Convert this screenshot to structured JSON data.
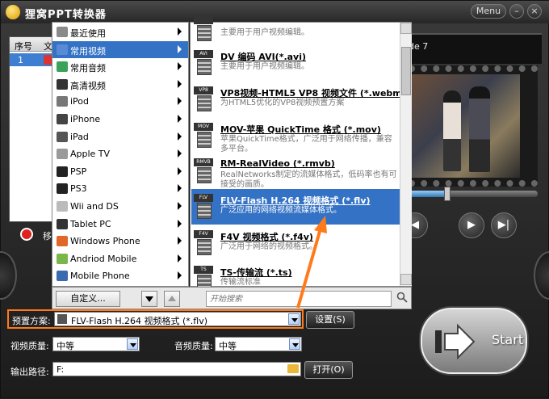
{
  "title": "狸窝PPT转换器",
  "window_buttons": {
    "menu": "Menu",
    "minimize": "–",
    "close": "×"
  },
  "filelist": {
    "col_index": "序号",
    "col_file": "文",
    "rows": [
      {
        "index": "1"
      }
    ],
    "delete_label": "移"
  },
  "preview": {
    "slide_label": "de 7",
    "seek_fraction": 0.3
  },
  "categories": [
    {
      "label": "最近使用",
      "icon": "clock-icon",
      "color": "#8a8a8a"
    },
    {
      "label": "常用视频",
      "icon": "film-icon",
      "color": "#5a8ad6"
    },
    {
      "label": "常用音频",
      "icon": "audio-icon",
      "color": "#3aa35a"
    },
    {
      "label": "高清视频",
      "icon": "hd-icon",
      "color": "#333333"
    },
    {
      "label": "iPod",
      "icon": "ipod-icon",
      "color": "#777777"
    },
    {
      "label": "iPhone",
      "icon": "iphone-icon",
      "color": "#444444"
    },
    {
      "label": "iPad",
      "icon": "ipad-icon",
      "color": "#555555"
    },
    {
      "label": "Apple TV",
      "icon": "apple-icon",
      "color": "#9a9a9a"
    },
    {
      "label": "PSP",
      "icon": "psp-icon",
      "color": "#222222"
    },
    {
      "label": "PS3",
      "icon": "ps3-icon",
      "color": "#222222"
    },
    {
      "label": "Wii and DS",
      "icon": "wii-icon",
      "color": "#bbbbbb"
    },
    {
      "label": "Tablet PC",
      "icon": "tablet-icon",
      "color": "#333333"
    },
    {
      "label": "Windows Phone",
      "icon": "windows-icon",
      "color": "#e0662a"
    },
    {
      "label": "Andriod Mobile",
      "icon": "android-icon",
      "color": "#7ab648"
    },
    {
      "label": "Mobile Phone",
      "icon": "phone-icon",
      "color": "#3a6ab0"
    }
  ],
  "selected_category": 1,
  "formats": [
    {
      "tag": "",
      "title": "",
      "desc": "主要用于用户视频编辑。"
    },
    {
      "tag": "AVI",
      "title": "DV 编码 AVI(*.avi)",
      "desc": "主要用于用户视频编辑。"
    },
    {
      "tag": "VP8",
      "title": "VP8视频-HTML5 VP8 视频文件 (*.webm)",
      "desc": "为HTML5优化的VP8视频预置方案"
    },
    {
      "tag": "MOV",
      "title": "MOV-苹果 QuickTime 格式 (*.mov)",
      "desc": "苹果QuickTime格式，广泛用于网络传播，兼容多平台。"
    },
    {
      "tag": "RMVB",
      "title": "RM-RealVideo (*.rmvb)",
      "desc": "RealNetworks制定的流媒体格式，低码率也有可接受的画质。"
    },
    {
      "tag": "FLV",
      "title": "FLV-Flash H.264 视频格式 (*.flv)",
      "desc": "广泛应用的网络视频流媒体格式。"
    },
    {
      "tag": "F4V",
      "title": "F4V 视频格式 (*.f4v)",
      "desc": "广泛用于网络的视频格式。"
    },
    {
      "tag": "TS",
      "title": "TS-传输流 (*.ts)",
      "desc": "传输流标准"
    }
  ],
  "selected_format": 5,
  "popup": {
    "custom_label": "自定义...",
    "search_placeholder": "开始搜索"
  },
  "settings": {
    "preset_label": "预置方案:",
    "preset_value": "FLV-Flash H.264 视频格式 (*.flv)",
    "settings_button": "设置(S)",
    "video_quality_label": "视频质量:",
    "video_quality_value": "中等",
    "audio_quality_label": "音频质量:",
    "audio_quality_value": "中等",
    "output_label": "输出路径:",
    "output_value": "F:",
    "open_button": "打开(O)"
  },
  "start_label": "Start",
  "colors": {
    "accent": "#3472c5",
    "highlight": "#ff7a1a"
  }
}
